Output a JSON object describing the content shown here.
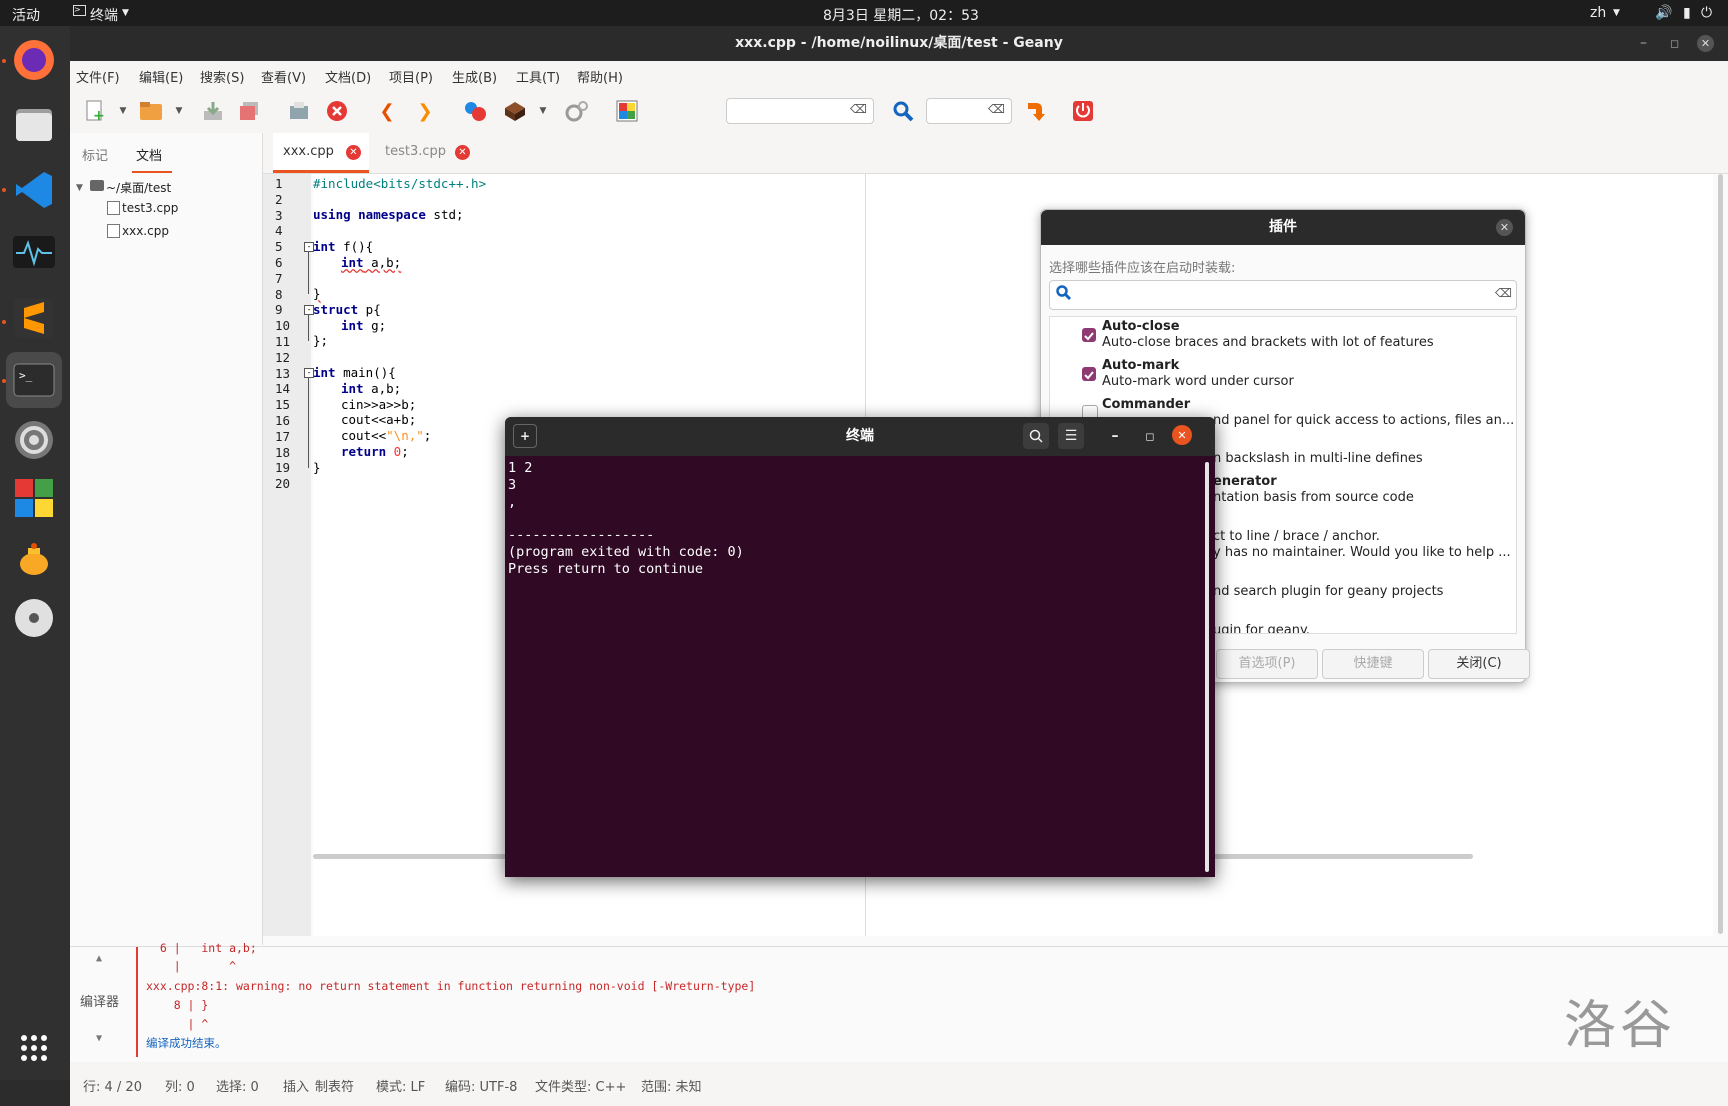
{
  "topbar": {
    "activities": "活动",
    "app_menu": "终端",
    "clock": "8月3日 星期二，02：53",
    "input_method": "zh"
  },
  "dock": {
    "items": [
      "firefox-icon",
      "files-icon",
      "vscode-icon",
      "system-monitor-icon",
      "sublime-text-icon",
      "terminal-icon",
      "settings-icon",
      "windows-logo-icon",
      "teapot-icon",
      "disc-icon",
      "app-grid-icon"
    ]
  },
  "window": {
    "title": "xxx.cpp - /home/noilinux/桌面/test - Geany"
  },
  "menu": [
    "文件(F)",
    "编辑(E)",
    "搜索(S)",
    "查看(V)",
    "文档(D)",
    "项目(P)",
    "生成(B)",
    "工具(T)",
    "帮助(H)"
  ],
  "sidebar": {
    "tabs": [
      "标记",
      "文档"
    ],
    "folder": "~/桌面/test",
    "files": [
      "test3.cpp",
      "xxx.cpp"
    ]
  },
  "editor": {
    "tabs": [
      "xxx.cpp",
      "test3.cpp"
    ],
    "line_numbers": [
      "1",
      "2",
      "3",
      "4",
      "5",
      "6",
      "7",
      "8",
      "9",
      "10",
      "11",
      "12",
      "13",
      "14",
      "15",
      "16",
      "17",
      "18",
      "19",
      "20"
    ]
  },
  "code": {
    "l1": "#include<bits/stdc++.h>",
    "l3_kw": "using namespace",
    "l3_rest": " std;",
    "l5_kw": "int",
    "l5_rest": " f(){",
    "l6_kw": "int",
    "l6_rest": " a,b;",
    "l8": "}",
    "l9_kw": "struct",
    "l9_rest": " p{",
    "l10_kw": "int",
    "l10_rest": " g;",
    "l11": "};",
    "l13_kw": "int",
    "l13_rest": " main(){",
    "l14_kw": "int",
    "l14_rest": " a,b;",
    "l15": "cin>>a>>b;",
    "l16": "cout<<a+b;",
    "l17_a": "cout<<",
    "l17_str": "\"\\n,\"",
    "l17_b": ";",
    "l18_kw": "return",
    "l18_num": " 0",
    "l18_b": ";",
    "l19": "}"
  },
  "messages": {
    "tab_label": "编译器",
    "line0": "  6 |   int a,b;",
    "line1": "    |       ^",
    "warning": "xxx.cpp:8:1: warning: no return statement in function returning non-void [-Wreturn-type]",
    "line3": "    8 | }",
    "line4": "      | ^",
    "done": "编译成功结束。"
  },
  "watermark": "洛谷",
  "status": {
    "line": "行: 4 / 20",
    "col": "列: 0",
    "sel": "选择: 0",
    "mode_ins": "插入",
    "tab": "制表符",
    "eol": "模式: LF",
    "enc": "编码: UTF-8",
    "ftype": "文件类型: C++",
    "scope": "范围: 未知"
  },
  "plugins": {
    "title": "插件",
    "prompt": "选择哪些插件应该在启动时装载:",
    "items": [
      {
        "name": "Auto-close",
        "desc": "Auto-close braces and brackets with lot of features",
        "checked": true
      },
      {
        "name": "Auto-mark",
        "desc": "Auto-mark word under cursor",
        "checked": true
      },
      {
        "name": "Commander",
        "desc": "nd panel for quick access to actions, files an...",
        "checked": false
      }
    ],
    "partial": [
      "n backslash in multi-line defines",
      "enerator",
      "ntation basis from source code",
      "ct to line / brace / anchor.",
      "y has no maintainer. Would you like to help ...",
      "nd search plugin for geany projects",
      "ugin for geany."
    ],
    "buttons": [
      "首选项(P)",
      "快捷键",
      "关闭(C)"
    ]
  },
  "terminal": {
    "title": "终端",
    "lines": [
      "1 2",
      "3",
      ",",
      "",
      "------------------",
      "(program exited with code: 0)",
      "Press return to continue"
    ]
  }
}
